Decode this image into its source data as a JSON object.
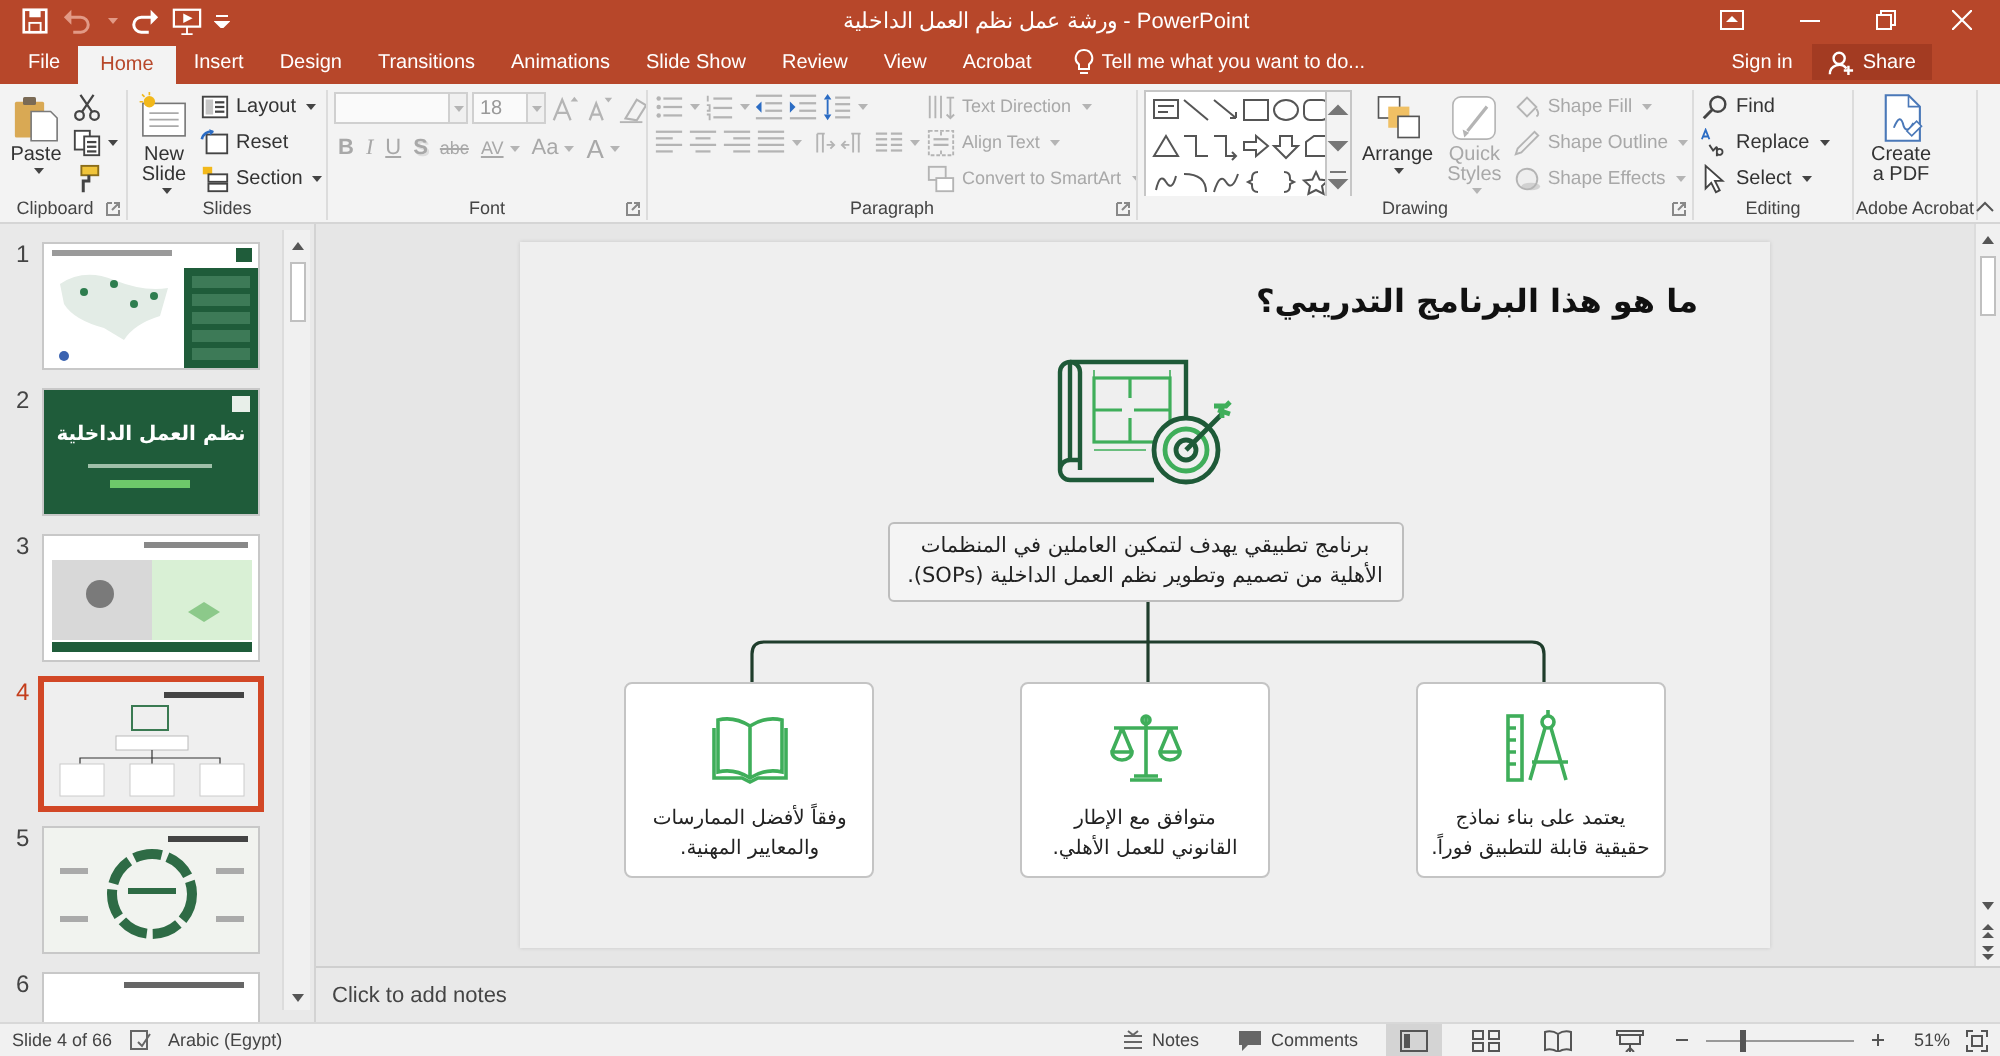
{
  "window": {
    "title": "ورشة عمل نظم العمل الداخلية - PowerPoint",
    "quick_access": [
      {
        "disabled": false
      },
      {
        "disabled": true
      },
      {
        "disabled": false
      },
      {
        "disabled": false
      }
    ]
  },
  "tabs": [
    {
      "label": "File",
      "selected": false
    },
    {
      "label": "Home",
      "selected": true
    },
    {
      "label": "Insert",
      "selected": false
    },
    {
      "label": "Design",
      "selected": false
    },
    {
      "label": "Transitions",
      "selected": false
    },
    {
      "label": "Animations",
      "selected": false
    },
    {
      "label": "Slide Show",
      "selected": false
    },
    {
      "label": "Review",
      "selected": false
    },
    {
      "label": "View",
      "selected": false
    },
    {
      "label": "Acrobat",
      "selected": false
    }
  ],
  "tell_me": {
    "placeholder": "Tell me what you want to do..."
  },
  "sign_in": "Sign in",
  "share": "Share",
  "ribbon": {
    "groups": [
      {
        "label": "Clipboard",
        "launcher": true,
        "columns": [
          [
            [
              {
                "kind": "large",
                "label": "Paste",
                "menu": true,
                "disabled": false
              }
            ]
          ],
          [
            [
              {
                "kind": "icon",
                "menu": false,
                "disabled": false
              }
            ],
            [
              {
                "kind": "icon",
                "menu": true,
                "disabled": false
              }
            ],
            [
              {
                "kind": "icon",
                "menu": false,
                "disabled": false
              }
            ]
          ]
        ]
      },
      {
        "label": "Slides",
        "launcher": false,
        "columns": [
          [
            [
              {
                "kind": "large",
                "label": "New Slide",
                "menu": true,
                "disabled": false
              }
            ]
          ],
          [
            [
              {
                "kind": "small",
                "label": "Layout",
                "menu": true,
                "disabled": false
              }
            ],
            [
              {
                "kind": "small",
                "label": "Reset",
                "menu": false,
                "disabled": false
              }
            ],
            [
              {
                "kind": "small",
                "label": "Section",
                "menu": true,
                "disabled": false
              }
            ]
          ]
        ]
      },
      {
        "label": "Font",
        "launcher": true,
        "columns": [
          [
            [
              {
                "kind": "field",
                "menu": true,
                "disabled": true
              },
              {
                "kind": "field",
                "value": "18",
                "menu": true,
                "disabled": true
              },
              {
                "kind": "icon",
                "menu": false,
                "disabled": true
              },
              {
                "kind": "icon",
                "menu": false,
                "disabled": true
              },
              {
                "kind": "icon",
                "menu": false,
                "disabled": true
              }
            ],
            [
              {
                "kind": "glyph",
                "label": "B",
                "menu": false,
                "disabled": true
              },
              {
                "kind": "glyph",
                "label": "I",
                "menu": false,
                "disabled": true
              },
              {
                "kind": "glyph",
                "label": "U",
                "menu": false,
                "disabled": true
              },
              {
                "kind": "glyph",
                "label": "S",
                "menu": false,
                "disabled": true
              },
              {
                "kind": "glyph",
                "label": "abc",
                "menu": false,
                "disabled": true
              },
              {
                "kind": "glyph",
                "label": "AV",
                "menu": true,
                "disabled": true
              },
              {
                "kind": "glyph",
                "label": "Aa",
                "menu": true,
                "disabled": true
              },
              {
                "kind": "glyph",
                "label": "A",
                "menu": true,
                "disabled": true
              }
            ]
          ]
        ]
      },
      {
        "label": "Paragraph",
        "launcher": true,
        "columns": [
          [
            [
              {
                "kind": "icon",
                "menu": true,
                "disabled": true
              },
              {
                "kind": "icon",
                "menu": true,
                "disabled": true
              },
              {
                "kind": "icon",
                "menu": false,
                "disabled": true
              },
              {
                "kind": "icon",
                "menu": false,
                "disabled": true
              },
              {
                "kind": "icon",
                "menu": true,
                "disabled": true
              }
            ],
            [
              {
                "kind": "icon",
                "menu": false,
                "disabled": true
              },
              {
                "kind": "icon",
                "menu": false,
                "disabled": true
              },
              {
                "kind": "icon",
                "menu": false,
                "disabled": true
              },
              {
                "kind": "icon",
                "menu": true,
                "disabled": true
              },
              {
                "kind": "icon",
                "menu": false,
                "disabled": true
              },
              {
                "kind": "icon",
                "menu": false,
                "disabled": true
              },
              {
                "kind": "icon",
                "menu": true,
                "disabled": true
              }
            ]
          ],
          [
            [
              {
                "kind": "small",
                "label": "Text Direction",
                "menu": true,
                "disabled": true
              }
            ],
            [
              {
                "kind": "small",
                "label": "Align Text",
                "menu": true,
                "disabled": true
              }
            ],
            [
              {
                "kind": "small",
                "label": "Convert to SmartArt",
                "menu": true,
                "disabled": true
              }
            ]
          ]
        ]
      },
      {
        "label": "Drawing",
        "launcher": true,
        "columns": [
          [
            [
              {
                "kind": "gallery",
                "menu": false,
                "disabled": false
              }
            ]
          ],
          [
            [
              {
                "kind": "large",
                "label": "Arrange",
                "menu": true,
                "disabled": false
              }
            ]
          ],
          [
            [
              {
                "kind": "large",
                "label": "Quick Styles",
                "menu": true,
                "disabled": true
              }
            ]
          ],
          [
            [
              {
                "kind": "small",
                "label": "Shape Fill",
                "menu": true,
                "disabled": true
              }
            ],
            [
              {
                "kind": "small",
                "label": "Shape Outline",
                "menu": true,
                "disabled": true
              }
            ],
            [
              {
                "kind": "small",
                "label": "Shape Effects",
                "menu": true,
                "disabled": true
              }
            ]
          ]
        ]
      },
      {
        "label": "Editing",
        "launcher": false,
        "columns": [
          [
            [
              {
                "kind": "small",
                "label": "Find",
                "menu": false,
                "disabled": false
              }
            ],
            [
              {
                "kind": "small",
                "label": "Replace",
                "menu": true,
                "disabled": false
              }
            ],
            [
              {
                "kind": "small",
                "label": "Select",
                "menu": true,
                "disabled": false
              }
            ]
          ]
        ]
      },
      {
        "label": "Adobe Acrobat",
        "launcher": false,
        "columns": [
          [
            [
              {
                "kind": "large",
                "label": "Create a PDF",
                "menu": false,
                "disabled": false
              }
            ]
          ]
        ]
      }
    ]
  },
  "slides": [
    {
      "number": "1",
      "kind": "map",
      "selected": false
    },
    {
      "number": "2",
      "kind": "cover",
      "title": "نظم العمل الداخلية",
      "selected": false
    },
    {
      "number": "3",
      "kind": "split",
      "selected": false
    },
    {
      "number": "4",
      "kind": "overview",
      "selected": true
    },
    {
      "number": "5",
      "kind": "cycle",
      "selected": false
    },
    {
      "number": "6",
      "kind": "plain",
      "selected": false
    }
  ],
  "slide": {
    "title": "ما هو هذا البرنامج التدريبي؟",
    "description": "برنامج تطبيقي يهدف لتمكين العاملين في المنظمات الأهلية من تصميم وتطوير نظم العمل الداخلية (SOPs).",
    "cards": [
      {
        "text": "يعتمد على بناء نماذج حقيقية قابلة للتطبيق فوراً."
      },
      {
        "text": "متوافق مع الإطار القانوني للعمل الأهلي."
      },
      {
        "text": "وفقاً لأفضل الممارسات والمعايير المهنية."
      }
    ]
  },
  "notes": {
    "placeholder": "Click to add notes"
  },
  "status_bar": {
    "slide_info": "Slide 4 of 66",
    "language": "Arabic (Egypt)",
    "notes": "Notes",
    "comments": "Comments",
    "views": [
      {
        "selected": true
      },
      {
        "selected": false
      },
      {
        "selected": false
      },
      {
        "selected": false
      }
    ],
    "zoom": {
      "level": 0.24,
      "reading": "51%"
    }
  }
}
